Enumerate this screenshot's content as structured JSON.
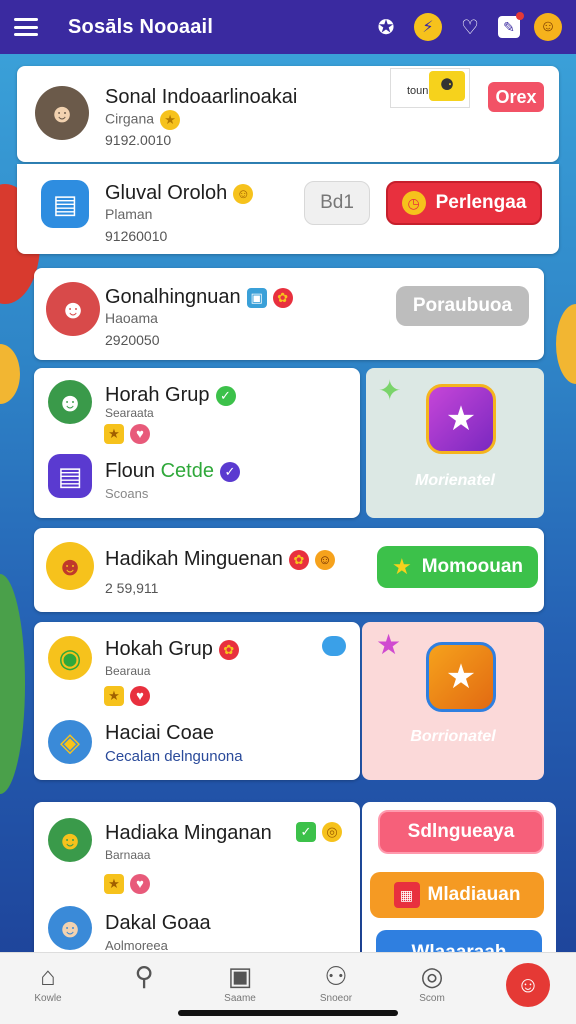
{
  "header": {
    "title": "Sosāls Nooaail"
  },
  "rows": [
    {
      "name": "Sonal Indoaarlinoakai",
      "sub": "Cirgana",
      "num": "9192.0010",
      "mini_tag": "tounis",
      "action": "Orex"
    },
    {
      "name": "Gluval Oroloh",
      "sub": "Plaman",
      "num": "91260010",
      "secondary": "Bd1",
      "action": "Perlengaa"
    },
    {
      "name": "Gonalhingnuan",
      "sub": "Haoama",
      "num": "2920050",
      "action": "Poraubuoa"
    },
    {
      "name": "Horah Grup",
      "sub": "Searaata",
      "name2a": "Floun",
      "name2b": "Cetde",
      "sub2": "Scoans",
      "panel_label": "Morienatel"
    },
    {
      "name": "Hadikah Minguenan",
      "num": "2 59,911",
      "action": "Momoouan"
    },
    {
      "name": "Hokah Grup",
      "sub": "Bearaua",
      "name2": "Haciai Coae",
      "sub2": "Cecalan delngunona",
      "panel_label": "Borrionatel"
    },
    {
      "name": "Hadiaka Minganan",
      "sub": "Barnaaa",
      "name2": "Dakal Goaa",
      "sub2": "Aolmoreea",
      "action1": "Sdlngueaya",
      "action2": "Mladiauan",
      "action3": "Wlaaaraah"
    }
  ],
  "nav": [
    {
      "label": "Kowle",
      "icon": "home-icon"
    },
    {
      "label": "",
      "icon": "search-icon"
    },
    {
      "label": "Saame",
      "icon": "tablet-icon"
    },
    {
      "label": "Snoeor",
      "icon": "people-icon"
    },
    {
      "label": "Scom",
      "icon": "compass-icon"
    },
    {
      "label": "",
      "icon": "profile-icon"
    }
  ],
  "colors": {
    "header": "#3a2aa0",
    "accent_red": "#e8303e",
    "green": "#3cc14a",
    "pink": "#f6607a",
    "orange": "#f59a23"
  }
}
